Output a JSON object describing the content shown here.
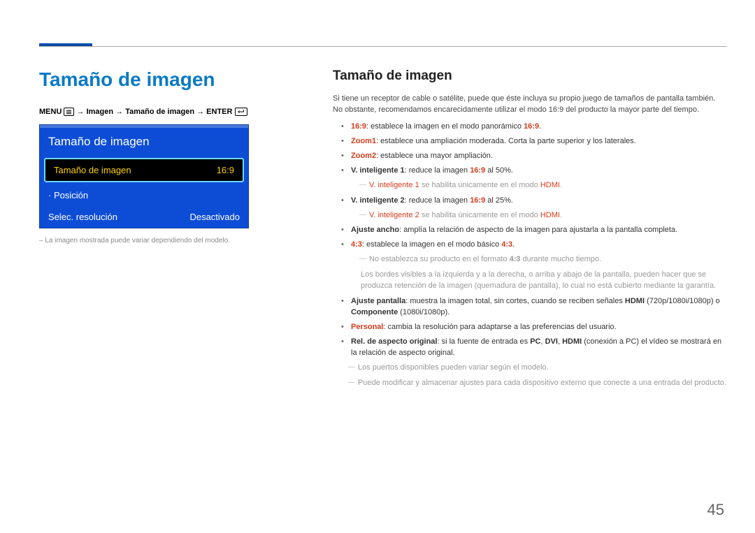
{
  "page": {
    "number": "45"
  },
  "left": {
    "title": "Tamaño de imagen",
    "breadcrumb": {
      "menu": "MENU",
      "sep": " → ",
      "p1": "Imagen",
      "p2": "Tamaño de imagen",
      "enter": "ENTER"
    },
    "osd": {
      "title": "Tamaño de imagen",
      "row1": {
        "label": "Tamaño de imagen",
        "value": "16:9"
      },
      "row2": {
        "label": "· Posición",
        "value": ""
      },
      "row3": {
        "label": "Selec. resolución",
        "value": "Desactivado"
      }
    },
    "note": "La imagen mostrada puede variar dependiendo del modelo."
  },
  "right": {
    "title": "Tamaño de imagen",
    "intro": "Si tiene un receptor de cable o satélite, puede que éste incluya su propio juego de tamaños de pantalla también. No obstante, recomendamos encarecidamente utilizar el modo 16:9 del producto la mayor parte del tiempo.",
    "li1": {
      "t": "16:9",
      "rest": ": establece la imagen en el modo panorámico ",
      "t2": "16:9",
      "rest2": "."
    },
    "li2": {
      "t": "Zoom1",
      "rest": ": establece una ampliación moderada. Corta la parte superior y los laterales."
    },
    "li3": {
      "t": "Zoom2",
      "rest": ": establece una mayor ampliación."
    },
    "li4": {
      "t": "V. inteligente 1",
      "rest": ": reduce la imagen ",
      "t2": "16:9",
      "rest2": " al 50%."
    },
    "li4sub": {
      "a": "V. inteligente 1",
      "rest": " se habilita únicamente en el modo ",
      "b": "HDMI",
      "dot": "."
    },
    "li5": {
      "t": "V. inteligente 2",
      "rest": ": reduce la imagen ",
      "t2": "16:9",
      "rest2": " al 25%."
    },
    "li5sub": {
      "a": "V. inteligente 2",
      "rest": " se habilita únicamente en el modo ",
      "b": "HDMI",
      "dot": "."
    },
    "li6": {
      "t": "Ajuste ancho",
      "rest": ": amplía la relación de aspecto de la imagen para ajustarla a la pantalla completa."
    },
    "li7": {
      "t": "4:3",
      "rest": ": establece la imagen en el modo básico ",
      "t2": "4:3",
      "rest2": "."
    },
    "li7sub1": {
      "pre": "No establezca su producto en el formato ",
      "b": "4:3",
      "rest": " durante mucho tiempo."
    },
    "li7sub2": "Los bordes visibles a la izquierda y a la derecha, o arriba y abajo de la pantalla, pueden hacer que se produzca retención de la imagen (quemadura de pantalla), lo cual no está cubierto mediante la garantía.",
    "li8": {
      "t": "Ajuste pantalla",
      "rest": ": muestra la imagen total, sin cortes, cuando se reciben señales ",
      "h": "HDMI",
      "rest2": " (720p/1080i/1080p) o ",
      "c": "Componente",
      "rest3": " (1080i/1080p)."
    },
    "li9": {
      "t": "Personal",
      "rest": ": cambia la resolución para adaptarse a las preferencias del usuario."
    },
    "li10": {
      "t": "Rel. de aspecto original",
      "rest": ": si la fuente de entrada es ",
      "a": "PC",
      "comma1": ", ",
      "b": "DVI",
      "comma2": ", ",
      "c": "HDMI",
      "rest2": " (conexión a PC) el vídeo se mostrará en la relación de aspecto original."
    },
    "endsub1": "Los puertos disponibles pueden variar según el modelo.",
    "endsub2": "Puede modificar y almacenar ajustes para cada dispositivo externo que conecte a una entrada del producto."
  }
}
